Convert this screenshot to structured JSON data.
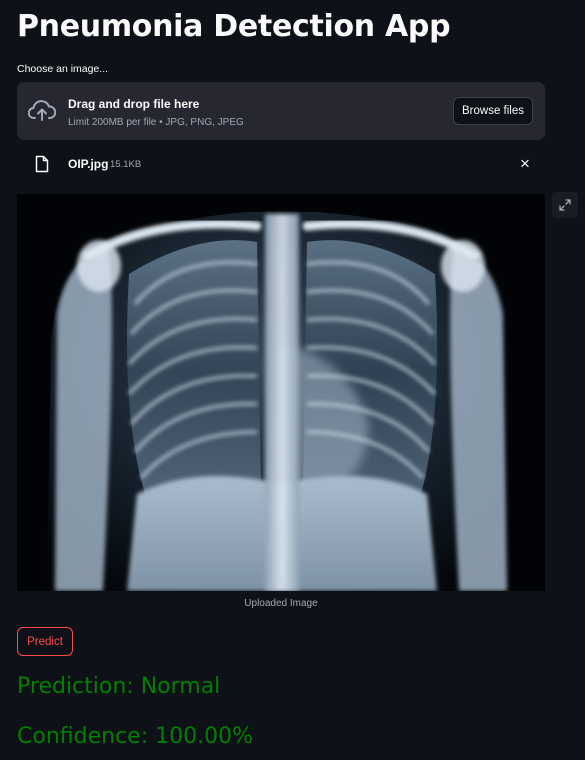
{
  "app": {
    "title": "Pneumonia Detection App"
  },
  "uploader": {
    "label": "Choose an image...",
    "drop_title": "Drag and drop file here",
    "limit_text": "Limit 200MB per file • JPG, PNG, JPEG",
    "browse_label": "Browse files"
  },
  "file": {
    "name": "OIP.jpg",
    "size": "15.1KB"
  },
  "image": {
    "caption": "Uploaded Image"
  },
  "actions": {
    "predict_label": "Predict"
  },
  "results": {
    "prediction": "Prediction: Normal",
    "confidence": "Confidence: 100.00%"
  },
  "icons": {
    "upload": "cloud-upload-icon",
    "file": "file-icon",
    "close": "close-icon",
    "expand": "fullscreen-icon"
  },
  "colors": {
    "background": "#0e1117",
    "panel": "#262730",
    "accent": "#ff4b4b",
    "result_text": "#008000"
  }
}
